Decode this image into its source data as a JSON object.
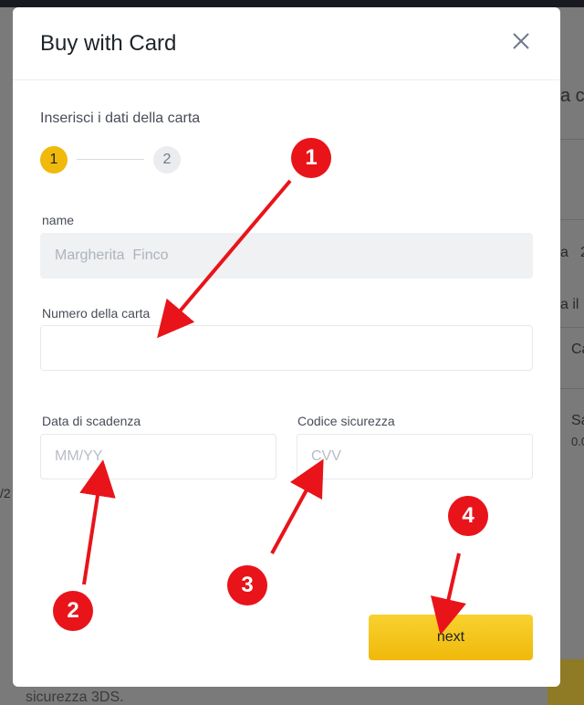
{
  "background": {
    "fragments": [
      "a c",
      "a",
      "2",
      "a il n",
      "Ca",
      "Sa",
      "0.0",
      "/2"
    ],
    "below_text": "sicurezza 3DS."
  },
  "modal": {
    "title": "Buy with Card",
    "subtitle": "Inserisci i dati della carta",
    "steps": [
      "1",
      "2"
    ],
    "active_step": 1,
    "name_label": "name",
    "name_value": "Margherita  Finco",
    "card_number_label": "Numero della carta",
    "card_number_value": "",
    "expiry_label": "Data di scadenza",
    "expiry_placeholder": "MM/YY",
    "cvv_label": "Codice sicurezza",
    "cvv_placeholder": "CVV",
    "next_label": "next"
  },
  "annotations": {
    "badges": [
      "1",
      "2",
      "3",
      "4"
    ],
    "badge_color": "#e8141a"
  },
  "colors": {
    "accent": "#f0b90b",
    "title": "#1e2329",
    "overlay": "#7a7a7a"
  }
}
